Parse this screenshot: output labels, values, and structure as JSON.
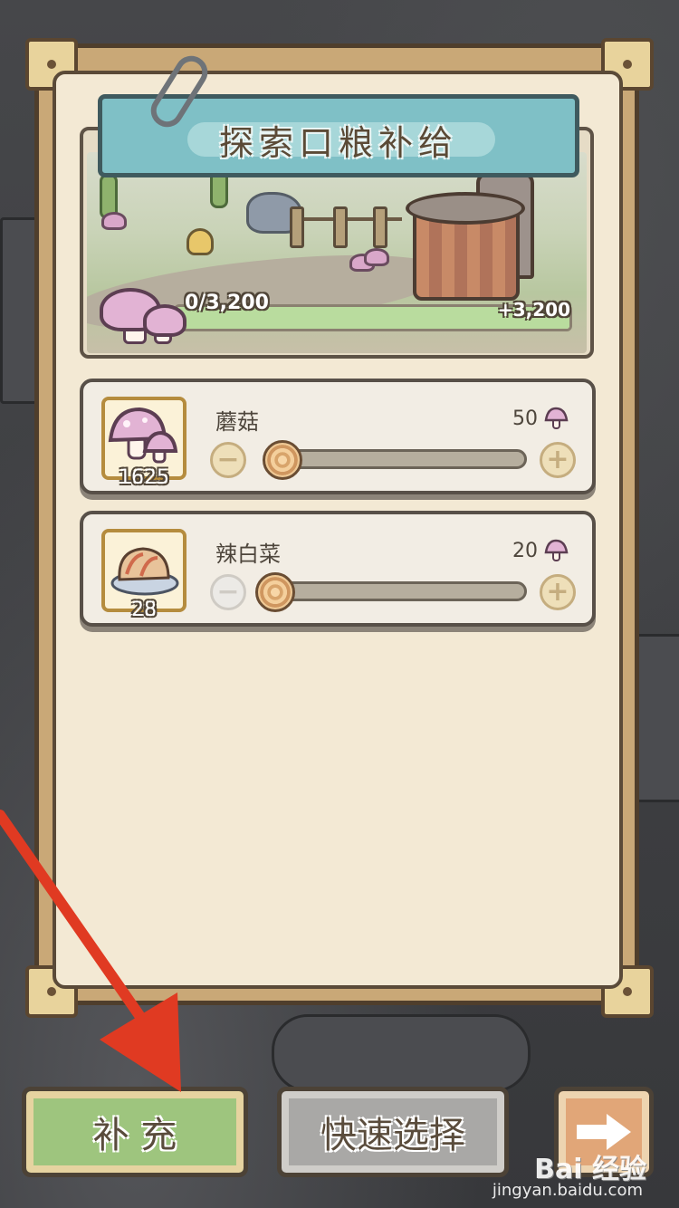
{
  "header": {
    "title": "探索口粮补给"
  },
  "progress": {
    "current_label": "0/3,200",
    "added_label": "+3,200",
    "preview_fraction": 1.0
  },
  "items": [
    {
      "name": "蘑菇",
      "stock": "1625",
      "cost": "50",
      "icon": "mushroom-icon",
      "slider_fraction": 0.0,
      "minus_enabled": true
    },
    {
      "name": "辣白菜",
      "stock": "28",
      "cost": "20",
      "icon": "kimchi-icon",
      "slider_fraction": 0.0,
      "minus_enabled": false
    }
  ],
  "buttons": {
    "supply": "补 充",
    "quick_select": "快速选择",
    "next": "next-arrow-icon"
  },
  "watermark": {
    "brand": "Bai 经验",
    "url": "jingyan.baidu.com"
  },
  "colors": {
    "accent_green": "#9ec57e",
    "progress_green": "#b9dc9e",
    "title_teal": "#7fc0c6",
    "annotation_red": "#e03a22"
  }
}
